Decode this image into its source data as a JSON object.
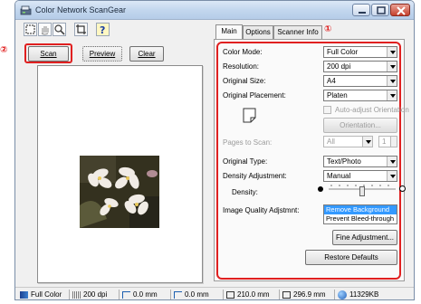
{
  "window": {
    "title": "Color Network ScanGear"
  },
  "callouts": {
    "one": "①",
    "two": "②"
  },
  "buttons": {
    "scan": "Scan",
    "preview": "Preview",
    "clear": "Clear"
  },
  "tabs": [
    {
      "label": "Main"
    },
    {
      "label": "Options"
    },
    {
      "label": "Scanner Info"
    }
  ],
  "main": {
    "color_mode": {
      "label": "Color Mode:",
      "value": "Full Color"
    },
    "resolution": {
      "label": "Resolution:",
      "value": "200 dpi"
    },
    "original_size": {
      "label": "Original Size:",
      "value": "A4"
    },
    "original_placement": {
      "label": "Original Placement:",
      "value": "Platen"
    },
    "auto_adjust_orientation": {
      "label": "Auto-adjust Orientation",
      "checked": false
    },
    "orientation_button": "Orientation...",
    "pages_to_scan": {
      "label": "Pages to Scan:",
      "value": "All",
      "count": "1"
    },
    "original_type": {
      "label": "Original Type:",
      "value": "Text/Photo"
    },
    "density_adjustment": {
      "label": "Density Adjustment:",
      "value": "Manual"
    },
    "density": {
      "label": "Density:",
      "level": 0.5
    },
    "image_quality": {
      "label": "Image Quality Adjstmnt:",
      "options": [
        "Remove Background",
        "Prevent Bleed-through"
      ],
      "selected": "Remove Background"
    },
    "fine_adjustment_button": "Fine Adjustment...",
    "restore_defaults_button": "Restore Defaults"
  },
  "status": {
    "color": "Full Color",
    "resolution": "200 dpi",
    "offset_x": "0.0 mm",
    "offset_y": "0.0 mm",
    "width": "210.0 mm",
    "height": "296.9 mm",
    "size": "11329KB"
  },
  "colors": {
    "accent_red": "#e02020",
    "selection_blue": "#3399ff"
  }
}
